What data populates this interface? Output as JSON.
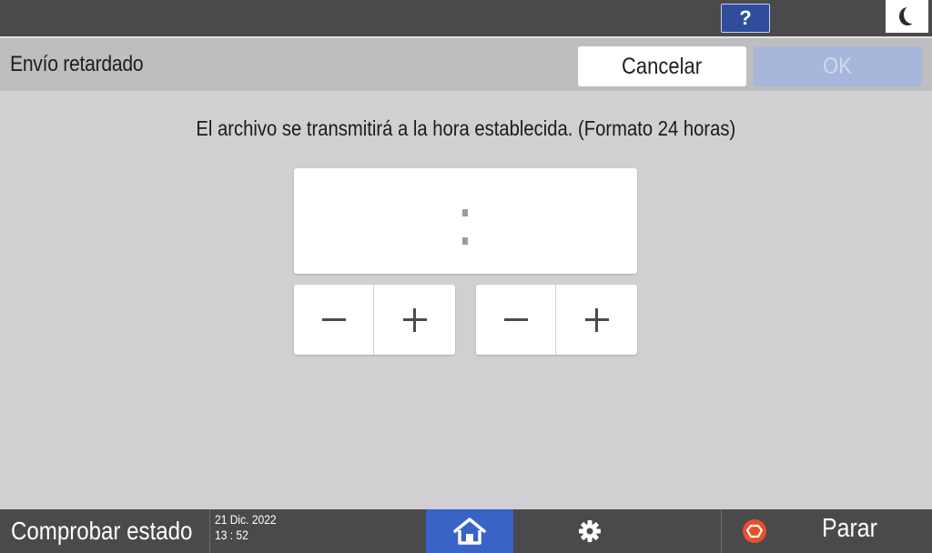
{
  "topbar": {
    "help_label": "?",
    "icons": {
      "help": "question-icon",
      "energy_saver": "moon-icon"
    }
  },
  "header": {
    "title": "Envío retardado",
    "cancel_label": "Cancelar",
    "ok_label": "OK",
    "ok_enabled": false
  },
  "main": {
    "message": "El archivo se transmitirá a la hora establecida. (Formato 24 horas)",
    "time_value": {
      "hours": "",
      "separator": ":",
      "minutes": ""
    },
    "steppers": [
      {
        "target": "hours",
        "icons": [
          "minus-icon",
          "plus-icon"
        ]
      },
      {
        "target": "minutes",
        "icons": [
          "minus-icon",
          "plus-icon"
        ]
      }
    ]
  },
  "bottombar": {
    "check_status_label": "Comprobar estado",
    "date": "21 Dic. 2022",
    "time": "13 : 52",
    "icons": {
      "home": "home-icon",
      "settings": "gear-icon",
      "stop": "stop-icon"
    },
    "stop_label": "Parar"
  },
  "colors": {
    "bar_bg": "#4a494c",
    "header_bg": "#bebdbf",
    "content_bg": "#d1cfd1",
    "accent_blue": "#3a63c7",
    "help_blue": "#2f4d9b",
    "ok_disabled": "#a7b6db",
    "stop_orange": "#e8502a"
  }
}
